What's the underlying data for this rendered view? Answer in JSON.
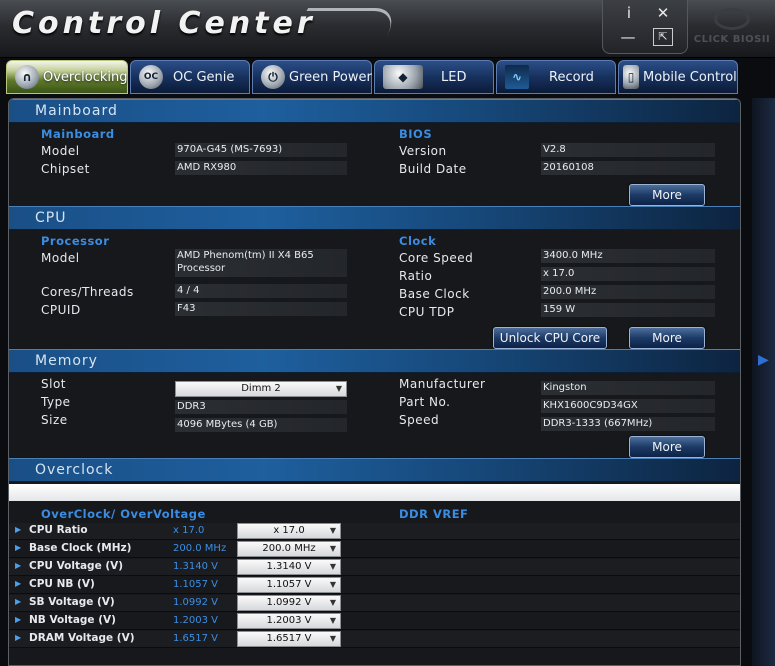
{
  "window": {
    "title": "Control Center",
    "click_bios_label": "CLICK BIOSII",
    "info_glyph": "i",
    "close_glyph": "✕",
    "min_glyph": "—",
    "restore_glyph": "⇱"
  },
  "tabs": [
    {
      "label": "Overclocking",
      "icon": "gauge-icon",
      "glyph": "∩",
      "active": true
    },
    {
      "label": "OC Genie",
      "icon": "oc-genie-icon",
      "glyph": "OC",
      "active": false
    },
    {
      "label": "Green Power",
      "icon": "power-icon",
      "glyph": "⏻",
      "active": false
    },
    {
      "label": "LED",
      "icon": "led-icon",
      "glyph": "◆",
      "active": false
    },
    {
      "label": "Record",
      "icon": "record-icon",
      "glyph": "∿",
      "active": false
    },
    {
      "label": "Mobile Control",
      "icon": "mobile-icon",
      "glyph": "▯",
      "active": false
    }
  ],
  "mainboard": {
    "header": "Mainboard",
    "sub_left": "Mainboard",
    "model_label": "Model",
    "model_value": "970A-G45 (MS-7693)",
    "chipset_label": "Chipset",
    "chipset_value": "AMD RX980",
    "sub_right": "BIOS",
    "version_label": "Version",
    "version_value": "V2.8",
    "build_label": "Build Date",
    "build_value": "20160108",
    "more_label": "More"
  },
  "cpu": {
    "header": "CPU",
    "sub_left": "Processor",
    "model_label": "Model",
    "model_value": "AMD Phenom(tm) II X4 B65 Processor",
    "cores_label": "Cores/Threads",
    "cores_value": "4 / 4",
    "cpuid_label": "CPUID",
    "cpuid_value": "F43",
    "sub_right": "Clock",
    "speed_label": "Core Speed",
    "speed_value": "3400.0 MHz",
    "ratio_label": "Ratio",
    "ratio_value": "x 17.0",
    "base_label": "Base Clock",
    "base_value": "200.0 MHz",
    "tdp_label": "CPU TDP",
    "tdp_value": "159 W",
    "unlock_label": "Unlock CPU Core",
    "more_label": "More"
  },
  "memory": {
    "header": "Memory",
    "slot_label": "Slot",
    "slot_value": "Dimm 2",
    "type_label": "Type",
    "type_value": "DDR3",
    "size_label": "Size",
    "size_value": "4096 MBytes (4 GB)",
    "mfr_label": "Manufacturer",
    "mfr_value": "Kingston",
    "part_label": "Part No.",
    "part_value": "KHX1600C9D34GX",
    "speed_label": "Speed",
    "speed_value": "DDR3-1333 (667MHz)",
    "more_label": "More"
  },
  "overclock": {
    "header": "Overclock",
    "sub_left": "OverClock/ OverVoltage",
    "sub_right": "DDR VREF",
    "arrow_glyph": "▶",
    "rows": [
      {
        "name": "CPU Ratio",
        "current": "x 17.0",
        "select": "x 17.0"
      },
      {
        "name": "Base Clock (MHz)",
        "current": "200.0 MHz",
        "select": "200.0 MHz"
      },
      {
        "name": "CPU Voltage (V)",
        "current": "1.3140 V",
        "select": "1.3140 V"
      },
      {
        "name": "CPU NB (V)",
        "current": "1.1057 V",
        "select": "1.1057 V"
      },
      {
        "name": "SB Voltage (V)",
        "current": "1.0992 V",
        "select": "1.0992 V"
      },
      {
        "name": "NB Voltage (V)",
        "current": "1.2003 V",
        "select": "1.2003 V"
      },
      {
        "name": "DRAM Voltage (V)",
        "current": "1.6517 V",
        "select": "1.6517 V"
      }
    ]
  },
  "colors": {
    "accent": "#3a8de3",
    "section_header": "#1e5f9e",
    "panel_bg": "#141619"
  }
}
